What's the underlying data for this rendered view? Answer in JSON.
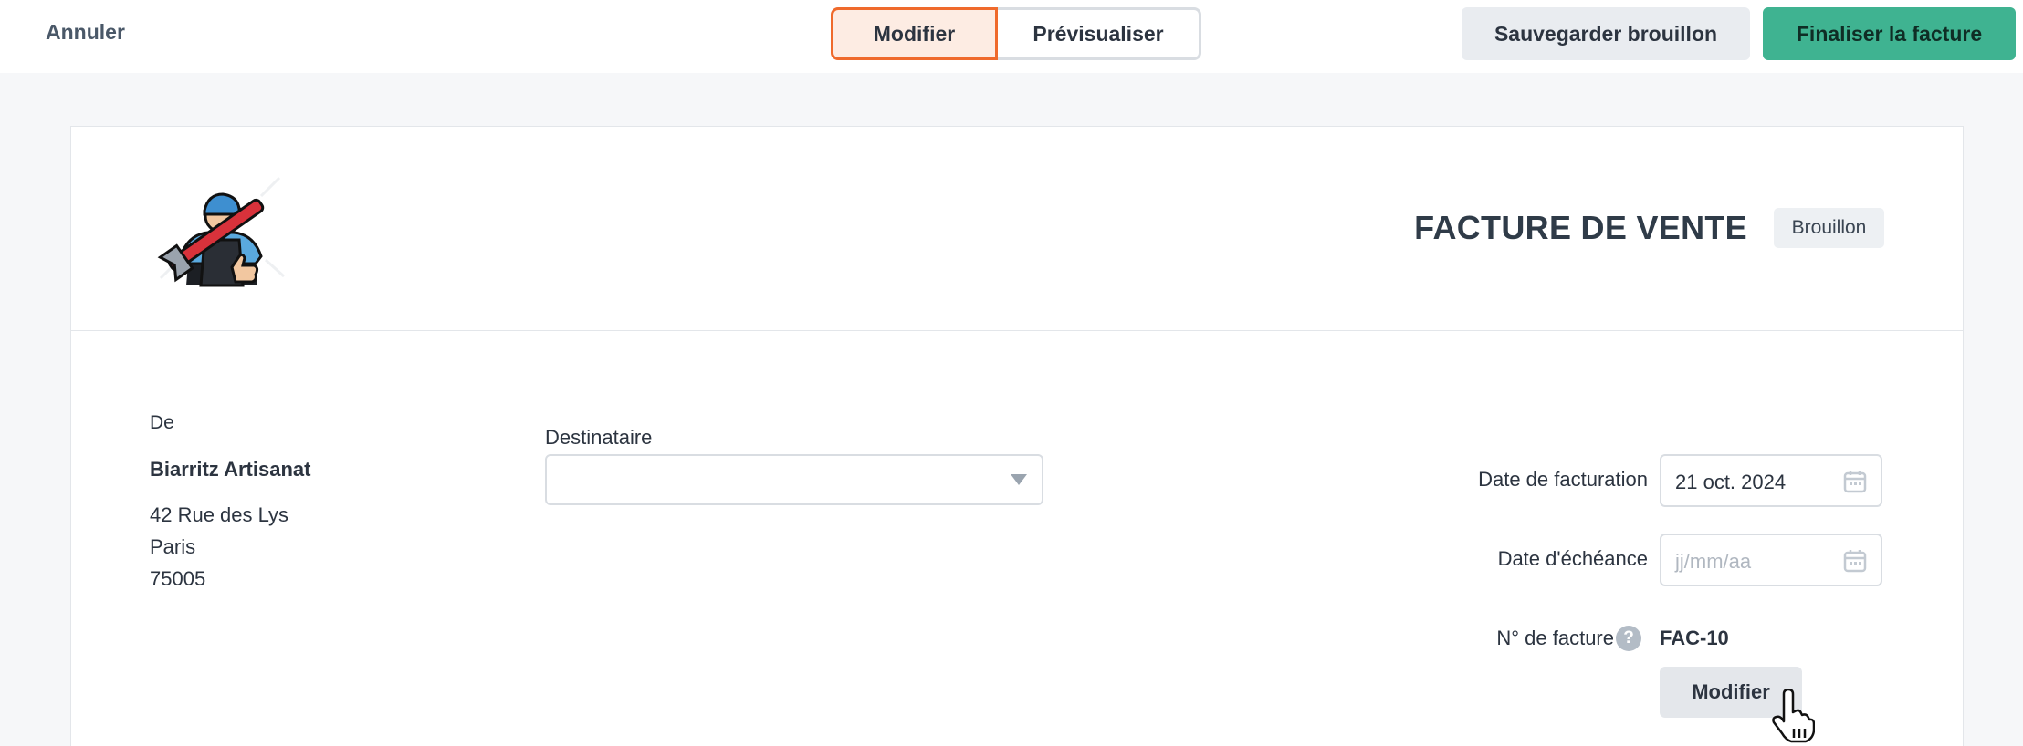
{
  "topbar": {
    "cancel_label": "Annuler",
    "mode_edit_label": "Modifier",
    "mode_preview_label": "Prévisualiser",
    "save_draft_label": "Sauvegarder brouillon",
    "finalize_label": "Finaliser la facture"
  },
  "invoice": {
    "title": "FACTURE DE VENTE",
    "status": "Brouillon",
    "from": {
      "label": "De",
      "name": "Biarritz Artisanat",
      "address_line1": "42 Rue des Lys",
      "city": "Paris",
      "postal_code": "75005"
    },
    "recipient": {
      "label": "Destinataire",
      "value": ""
    },
    "invoice_date": {
      "label": "Date de facturation",
      "value": "21 oct. 2024"
    },
    "due_date": {
      "label": "Date d'échéance",
      "placeholder": "jj/mm/aa"
    },
    "number": {
      "label": "N° de facture",
      "value": "FAC-10",
      "edit_label": "Modifier"
    }
  },
  "colors": {
    "accent_orange": "#ef6a2c",
    "finalize_green": "#3fb391",
    "page_background": "#f6f7f9"
  },
  "icons": [
    "plumber-logo-icon",
    "chevron-down-icon",
    "calendar-icon",
    "help-icon",
    "hand-cursor-icon"
  ]
}
